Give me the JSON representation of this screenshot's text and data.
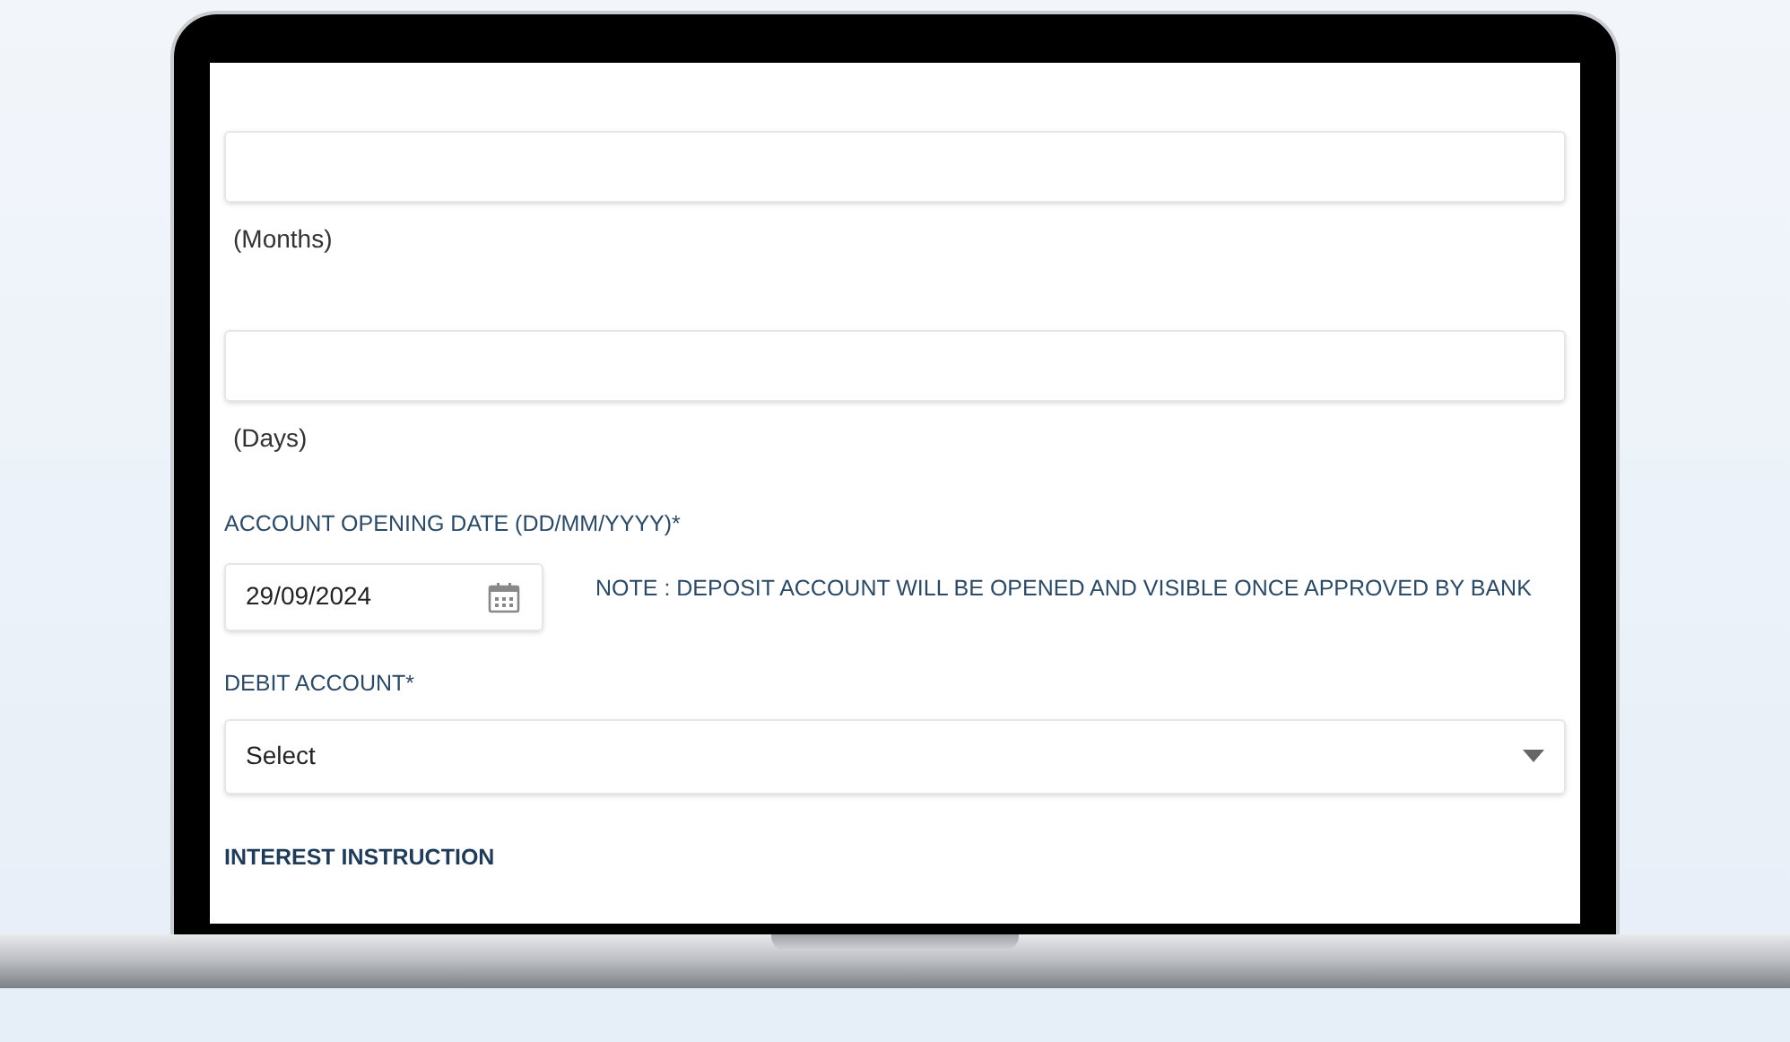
{
  "fields": [
    {
      "kind": "text",
      "caption": "(Months)"
    },
    {
      "kind": "text",
      "caption": "(Days)"
    }
  ],
  "opening_date": {
    "label": "ACCOUNT OPENING DATE (DD/MM/YYYY)*",
    "value": "29/09/2024",
    "note": "NOTE : DEPOSIT ACCOUNT WILL BE OPENED AND VISIBLE ONCE APPROVED BY BANK"
  },
  "debit_account": {
    "label": "DEBIT ACCOUNT*",
    "value": "Select"
  },
  "section_heading": "INTEREST INSTRUCTION"
}
